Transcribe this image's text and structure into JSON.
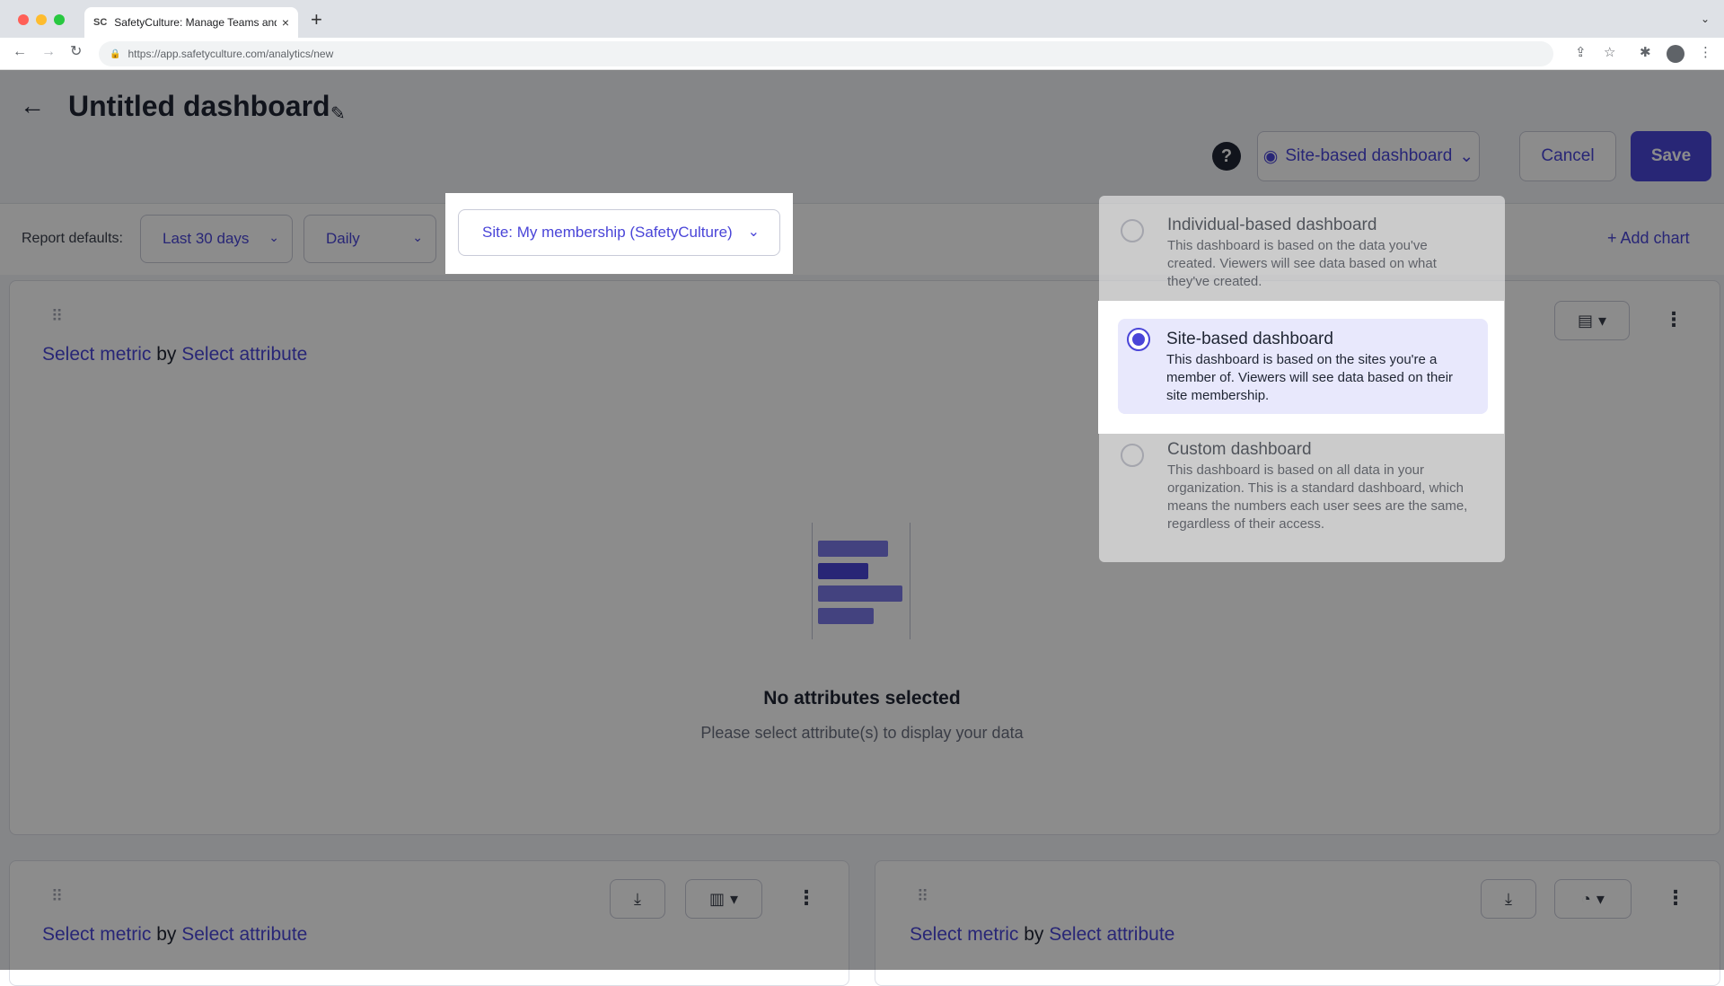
{
  "browser": {
    "tab_title": "SafetyCulture: Manage Teams and ...",
    "tab_favicon": "SC",
    "tab_close": "×",
    "new_tab": "+",
    "tab_menu": "⌄",
    "url": "https://app.safetyculture.com/analytics/new"
  },
  "header": {
    "back": "←",
    "title": "Untitled dashboard",
    "edit": "✎",
    "help": "?",
    "dashboard_type": "Site-based dashboard",
    "cancel": "Cancel",
    "save": "Save"
  },
  "defaults": {
    "label": "Report defaults:",
    "date_range": "Last 30 days",
    "interval": "Daily",
    "site_filter": "Site: My membership (SafetyCulture)",
    "add_chart": "Add chart"
  },
  "card": {
    "metric": "Select metric",
    "by": "by",
    "attribute": "Select attribute",
    "empty_title": "No attributes selected",
    "empty_sub": "Please select attribute(s) to display your data"
  },
  "menu": {
    "options": [
      {
        "title": "Individual-based dashboard",
        "desc": "This dashboard is based on the data you've created. Viewers will see data based on what they've created."
      },
      {
        "title": "Site-based dashboard",
        "desc": "This dashboard is based on the sites you're a member of. Viewers will see data based on their site membership."
      },
      {
        "title": "Custom dashboard",
        "desc": "This dashboard is based on all data in your organization. This is a standard dashboard, which means the numbers each user sees are the same, regardless of their access."
      }
    ],
    "selected_index": 1
  },
  "colors": {
    "accent": "#4a45d8",
    "selected_bg": "#e8e8fc",
    "overlay": "rgba(0,0,0,0.45)"
  }
}
